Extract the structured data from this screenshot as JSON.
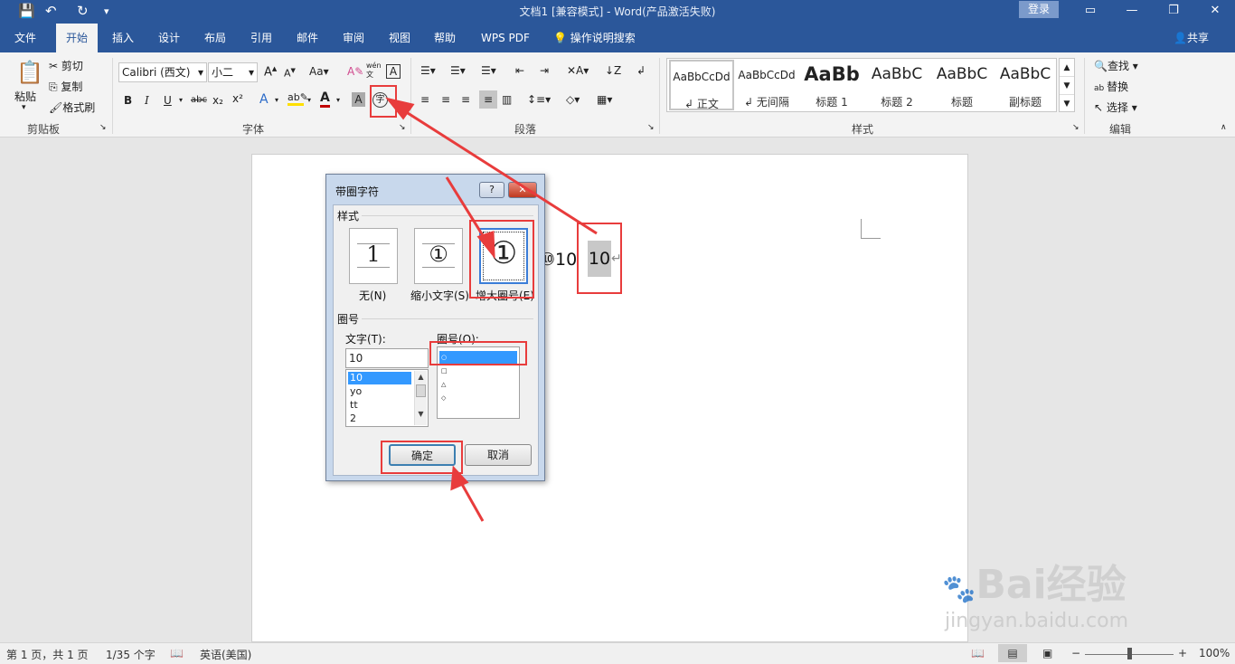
{
  "window": {
    "title": "文档1 [兼容模式] - Word(产品激活失败)",
    "login": "登录",
    "controls": [
      "▭",
      "—",
      "❐",
      "✕"
    ]
  },
  "quick_access": {
    "save": "💾",
    "undo": "↶",
    "redo": "↻",
    "more": "▾"
  },
  "tabs": [
    "文件",
    "开始",
    "插入",
    "设计",
    "布局",
    "引用",
    "邮件",
    "审阅",
    "视图",
    "帮助",
    "WPS PDF"
  ],
  "active_tab": "开始",
  "tell_me": "操作说明搜索",
  "share": "共享",
  "clipboard": {
    "paste": "粘贴",
    "cut": "剪切",
    "copy": "复制",
    "format_painter": "格式刷",
    "label": "剪贴板"
  },
  "font": {
    "name": "Calibri (西文)",
    "size": "小二",
    "label": "字体",
    "buttons": [
      "B",
      "I",
      "U",
      "abc",
      "x₂",
      "x²",
      "Aa",
      "A",
      "A"
    ]
  },
  "paragraph": {
    "label": "段落"
  },
  "styles": {
    "label": "样式",
    "items": [
      {
        "sample": "AaBbCcDd",
        "name": "正文"
      },
      {
        "sample": "AaBbCcDd",
        "name": "无间隔"
      },
      {
        "sample": "AaBb",
        "name": "标题 1"
      },
      {
        "sample": "AaBbC",
        "name": "标题 2"
      },
      {
        "sample": "AaBbC",
        "name": "标题"
      },
      {
        "sample": "AaBbC",
        "name": "副标题"
      }
    ]
  },
  "editing": {
    "find": "查找",
    "replace": "替换",
    "select": "选择",
    "label": "编辑"
  },
  "document": {
    "preview_text": "⑩10",
    "selected_text": "10"
  },
  "dialog": {
    "title": "带圈字符",
    "help": "?",
    "close": "✕",
    "style_section": "样式",
    "style_options": [
      {
        "glyph": "1",
        "label": "无(N)"
      },
      {
        "glyph": "①",
        "label": "缩小文字(S)"
      },
      {
        "glyph": "①",
        "label": "增大圈号(E)"
      }
    ],
    "enclose_section": "圈号",
    "text_label": "文字(T):",
    "text_value": "10",
    "text_list": [
      "10",
      "yo",
      "tt",
      "2"
    ],
    "circle_label": "圈号(O):",
    "circle_list": [
      "○",
      "□",
      "△",
      "◇"
    ],
    "ok": "确定",
    "cancel": "取消"
  },
  "status_bar": {
    "page": "第 1 页，共 1 页",
    "words": "1/35 个字",
    "language": "英语(美国)",
    "zoom": "100%"
  },
  "watermark": {
    "brand": "Bai经验",
    "url": "jingyan.baidu.com"
  },
  "colors": {
    "title_bar": "#2b579a",
    "ribbon": "#f3f3f3",
    "annotation": "#e83c3c",
    "selection": "#3399ff"
  }
}
